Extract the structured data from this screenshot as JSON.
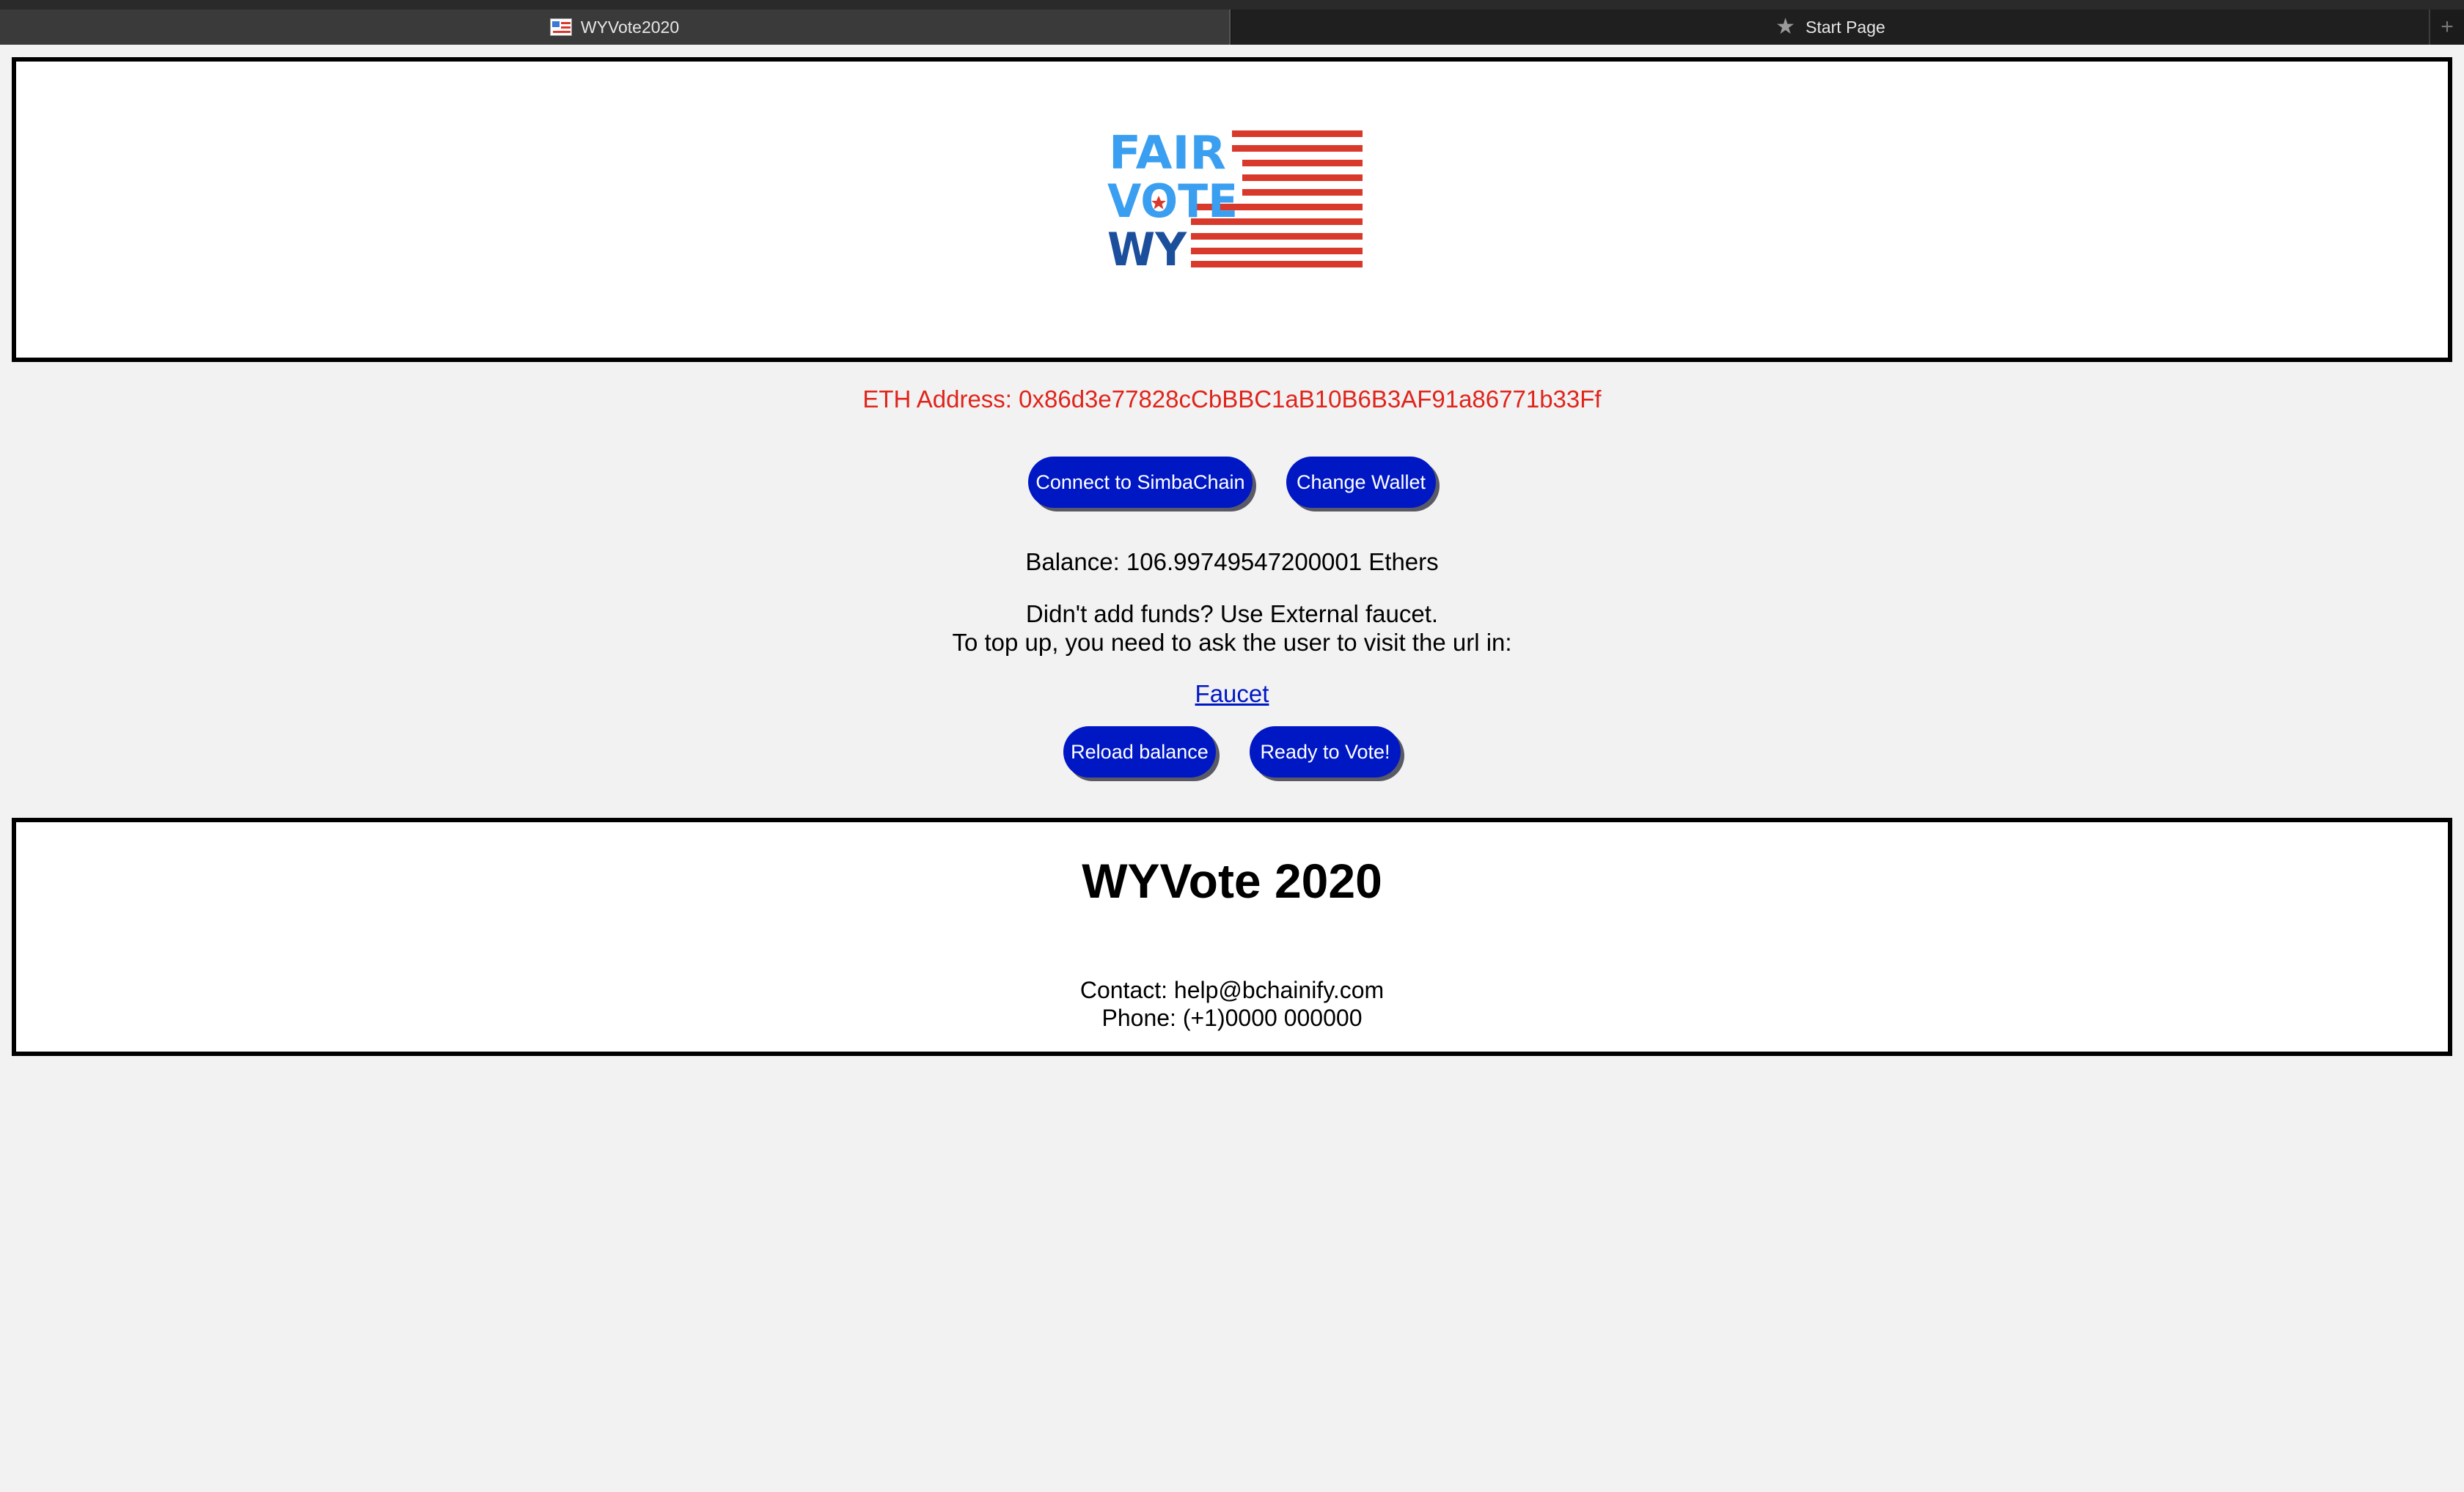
{
  "browser": {
    "tabs": [
      {
        "label": "WYVote2020",
        "active": true
      },
      {
        "label": "Start Page",
        "active": false
      }
    ],
    "new_tab_symbol": "+"
  },
  "header": {
    "logo": {
      "lines": [
        "FAIR",
        "VOTE",
        "WY"
      ],
      "colors": {
        "fair_vote": "#3a9ff0",
        "wy": "#1b4f9c",
        "stripes": "#d9392b"
      }
    }
  },
  "wallet": {
    "eth_address": "ETH Address: 0x86d3e77828cCbBBC1aB10B6B3AF91a86771b33Ff",
    "connect_label": "Connect to SimbaChain",
    "change_label": "Change Wallet",
    "balance": "Balance: 106.99749547200001 Ethers",
    "faucet_line1": "Didn't add funds? Use External faucet.",
    "faucet_line2": "To top up, you need to ask the user to visit the url in:",
    "faucet_link": "Faucet",
    "reload_label": "Reload balance",
    "ready_label": "Ready to Vote!"
  },
  "footer": {
    "title": "WYVote 2020",
    "contact": "Contact: help@bchainify.com",
    "phone": "Phone: (+1)0000 000000"
  },
  "colors": {
    "button_bg": "#0018c4",
    "address_red": "#e0241b",
    "page_bg": "#f2f2f2"
  }
}
